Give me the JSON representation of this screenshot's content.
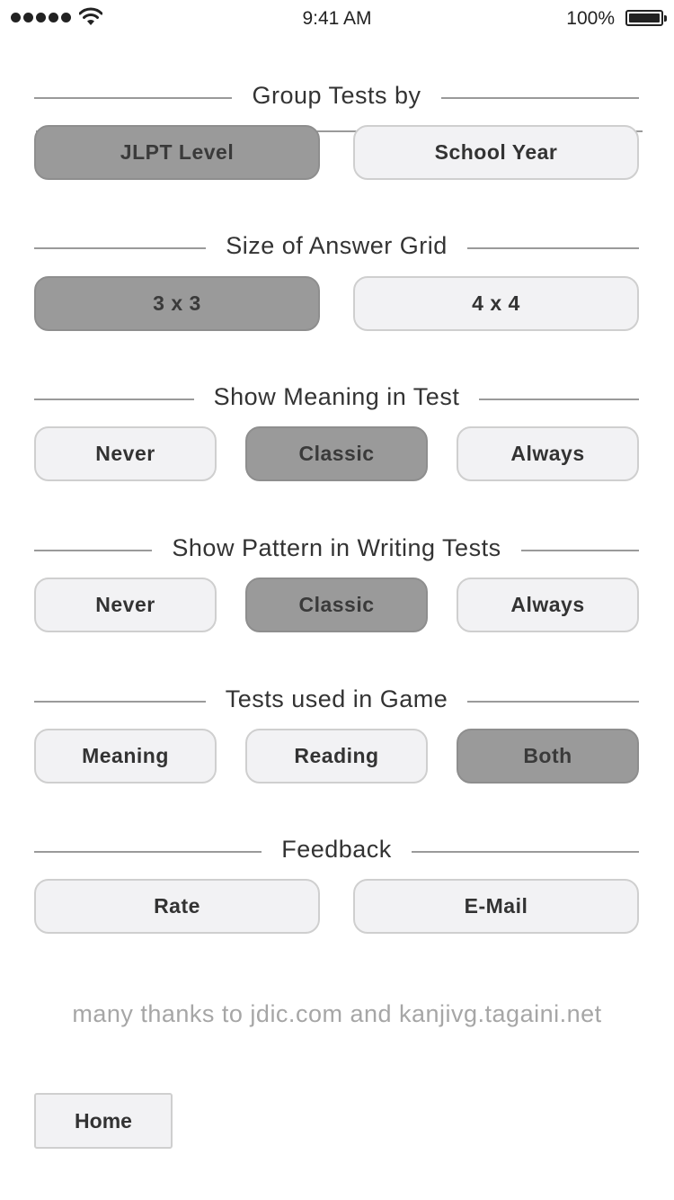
{
  "status_bar": {
    "time": "9:41 AM",
    "battery": "100%"
  },
  "sections": {
    "group": {
      "title": "Group Tests by",
      "options": [
        "JLPT Level",
        "School Year"
      ],
      "selected": "JLPT Level"
    },
    "grid": {
      "title": "Size of Answer Grid",
      "options": [
        "3 x 3",
        "4 x 4"
      ],
      "selected": "3 x 3"
    },
    "meaning": {
      "title": "Show Meaning in Test",
      "options": [
        "Never",
        "Classic",
        "Always"
      ],
      "selected": "Classic"
    },
    "pattern": {
      "title": "Show Pattern in Writing Tests",
      "options": [
        "Never",
        "Classic",
        "Always"
      ],
      "selected": "Classic"
    },
    "game": {
      "title": "Tests used in Game",
      "options": [
        "Meaning",
        "Reading",
        "Both"
      ],
      "selected": "Both"
    },
    "feedback": {
      "title": "Feedback",
      "options": [
        "Rate",
        "E-Mail"
      ]
    }
  },
  "thanks": "many thanks to jdic.com and kanjivg.tagaini.net",
  "home_label": "Home"
}
